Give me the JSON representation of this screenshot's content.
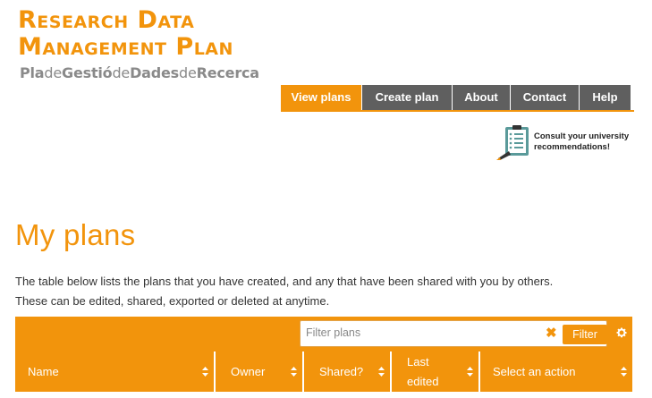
{
  "logo": {
    "line1": "Research Data",
    "line2": "Management Plan",
    "sub": [
      {
        "text": "Pla",
        "bold": true
      },
      {
        "text": "de",
        "bold": false
      },
      {
        "text": "Gestió",
        "bold": true
      },
      {
        "text": "de",
        "bold": false
      },
      {
        "text": "Dades",
        "bold": true
      },
      {
        "text": "de",
        "bold": false
      },
      {
        "text": "Recerca",
        "bold": true
      }
    ]
  },
  "nav": {
    "items": [
      {
        "label": "View plans",
        "active": true
      },
      {
        "label": "Create plan",
        "active": false
      },
      {
        "label": "About",
        "active": false
      },
      {
        "label": "Contact",
        "active": false
      },
      {
        "label": "Help",
        "active": false
      }
    ]
  },
  "consult": {
    "line1": "Consult your university",
    "line2": "recommendations!"
  },
  "page": {
    "title": "My plans",
    "intro_line1": "The table below lists the plans that you have created, and any that have been shared with you by others.",
    "intro_line2": "These can be edited, shared, exported or deleted at anytime."
  },
  "filter": {
    "placeholder": "Filter plans",
    "value": "",
    "clear_symbol": "✖",
    "button_label": "Filter"
  },
  "table": {
    "columns": [
      {
        "label": "Name"
      },
      {
        "label": "Owner"
      },
      {
        "label": "Shared?"
      },
      {
        "label": "Last edited"
      },
      {
        "label": "Select an action"
      }
    ]
  },
  "colors": {
    "accent": "#f2940c",
    "nav_bg": "#5f5f5f",
    "logo_sub": "#8a8a8a"
  },
  "icons": [
    "clipboard-icon",
    "clear-icon",
    "gear-icon",
    "sort-icon"
  ]
}
